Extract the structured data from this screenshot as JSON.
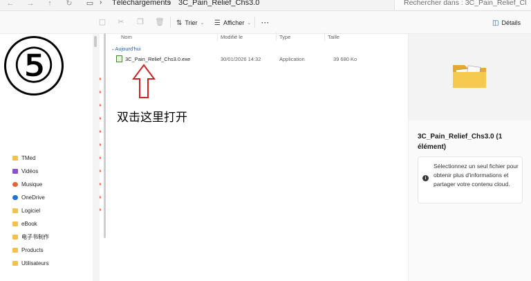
{
  "address_bar": {
    "breadcrumbs": [
      "Téléchargements",
      "3C_Pain_Relief_Chs3.0"
    ],
    "search_placeholder": "Rechercher dans : 3C_Pain_Relief_Cl"
  },
  "toolbar": {
    "sort_label": "Trier",
    "view_label": "Afficher",
    "more_label": "···",
    "details_label": "Détails"
  },
  "annotation": {
    "step_number": "⑤",
    "instruction": "双击这里打开"
  },
  "sidebar": {
    "items": [
      {
        "label": "TMed",
        "icon": "folder-icon",
        "color": "#f2c14e"
      },
      {
        "label": "Vidéos",
        "icon": "videos-icon",
        "color": "#8a4fd1"
      },
      {
        "label": "Musique",
        "icon": "music-icon",
        "color": "#e2643a"
      },
      {
        "label": "OneDrive",
        "icon": "onedrive-icon",
        "color": "#1e73d8"
      },
      {
        "label": "Logiciel",
        "icon": "folder-icon",
        "color": "#f2c14e"
      },
      {
        "label": "eBook",
        "icon": "folder-icon",
        "color": "#f2c14e"
      },
      {
        "label": "电子书制作",
        "icon": "folder-icon",
        "color": "#f2c14e"
      },
      {
        "label": "Products",
        "icon": "folder-icon",
        "color": "#f2c14e"
      },
      {
        "label": "Utilisateurs",
        "icon": "folder-icon",
        "color": "#f2c14e"
      }
    ]
  },
  "file_list": {
    "columns": [
      "Nom",
      "Modifié le",
      "Type",
      "Taille"
    ],
    "group_label": "Aujourd'hui",
    "rows": [
      {
        "name": "3C_Pain_Relief_Chs3.0.exe",
        "modified": "30/01/2026 14:32",
        "type": "Application",
        "size": "39 680 Ko"
      }
    ]
  },
  "details_pane": {
    "title": "3C_Pain_Relief_Chs3.0 (1 élément)",
    "info_text": "Sélectionnez un seul fichier pour obtenir plus d'informations et partager votre contenu cloud."
  },
  "colors": {
    "accent": "#2e5b9c",
    "arrow": "#d32020",
    "folder": "#f2c14e"
  }
}
